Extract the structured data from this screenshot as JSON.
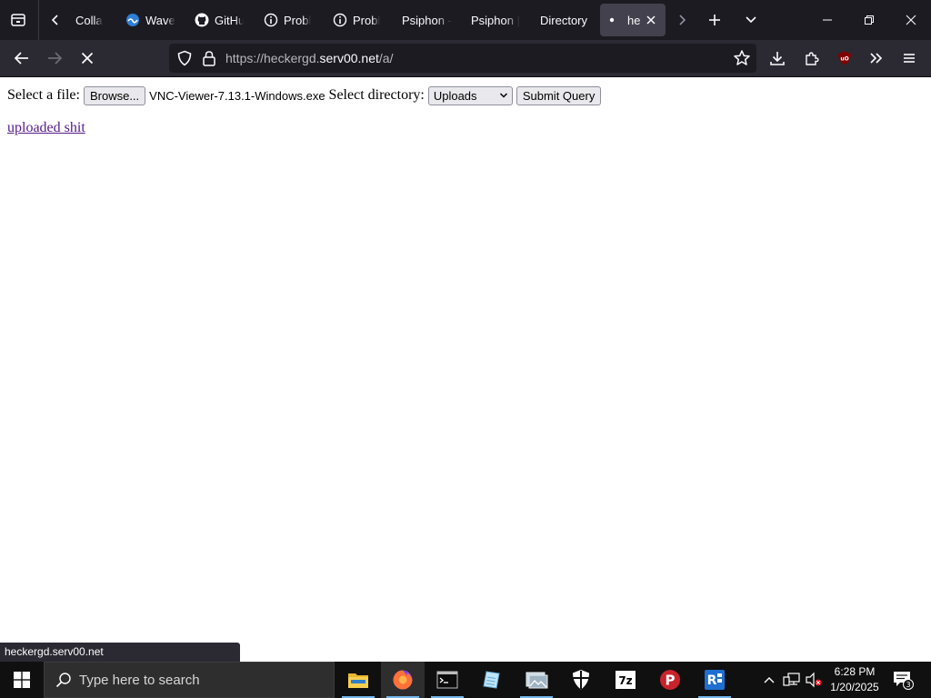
{
  "browser": {
    "tabs": [
      {
        "title": "Colla",
        "icon": "none"
      },
      {
        "title": "Wave",
        "icon": "wave-icon"
      },
      {
        "title": "GitHu",
        "icon": "github-icon"
      },
      {
        "title": "Probl",
        "icon": "info-icon"
      },
      {
        "title": "Probl",
        "icon": "info-icon"
      },
      {
        "title": "Psiphon -",
        "icon": "none"
      },
      {
        "title": "Psiphon |",
        "icon": "none"
      },
      {
        "title": "Directory",
        "icon": "none"
      }
    ],
    "active_tab": {
      "title": "he",
      "icon": "loading-dot-icon"
    },
    "url_prefix": "https://heckergd.",
    "url_domain": "serv00.net",
    "url_path": "/a/"
  },
  "page": {
    "file_label": "Select a file:",
    "browse_label": "Browse...",
    "selected_file": "VNC-Viewer-7.13.1-Windows.exe",
    "directory_label": "Select directory:",
    "directory_value": "Uploads",
    "submit_label": "Submit Query",
    "link_text": "uploaded shit"
  },
  "status_bar": "heckergd.serv00.net",
  "taskbar": {
    "search_placeholder": "Type here to search",
    "apps": [
      "file-explorer-icon",
      "firefox-icon",
      "terminal-icon",
      "notepad-icon",
      "photos-icon",
      "windows-security-icon",
      "7zip-icon",
      "psiphon-icon",
      "remote-desktop-icon"
    ],
    "time": "6:28 PM",
    "date": "1/20/2025",
    "notification_count": "3"
  },
  "colors": {
    "tabstrip": "#1c1b22",
    "navbar": "#2b2a33",
    "link_visited": "#551a8b",
    "taskbar": "#101010"
  }
}
